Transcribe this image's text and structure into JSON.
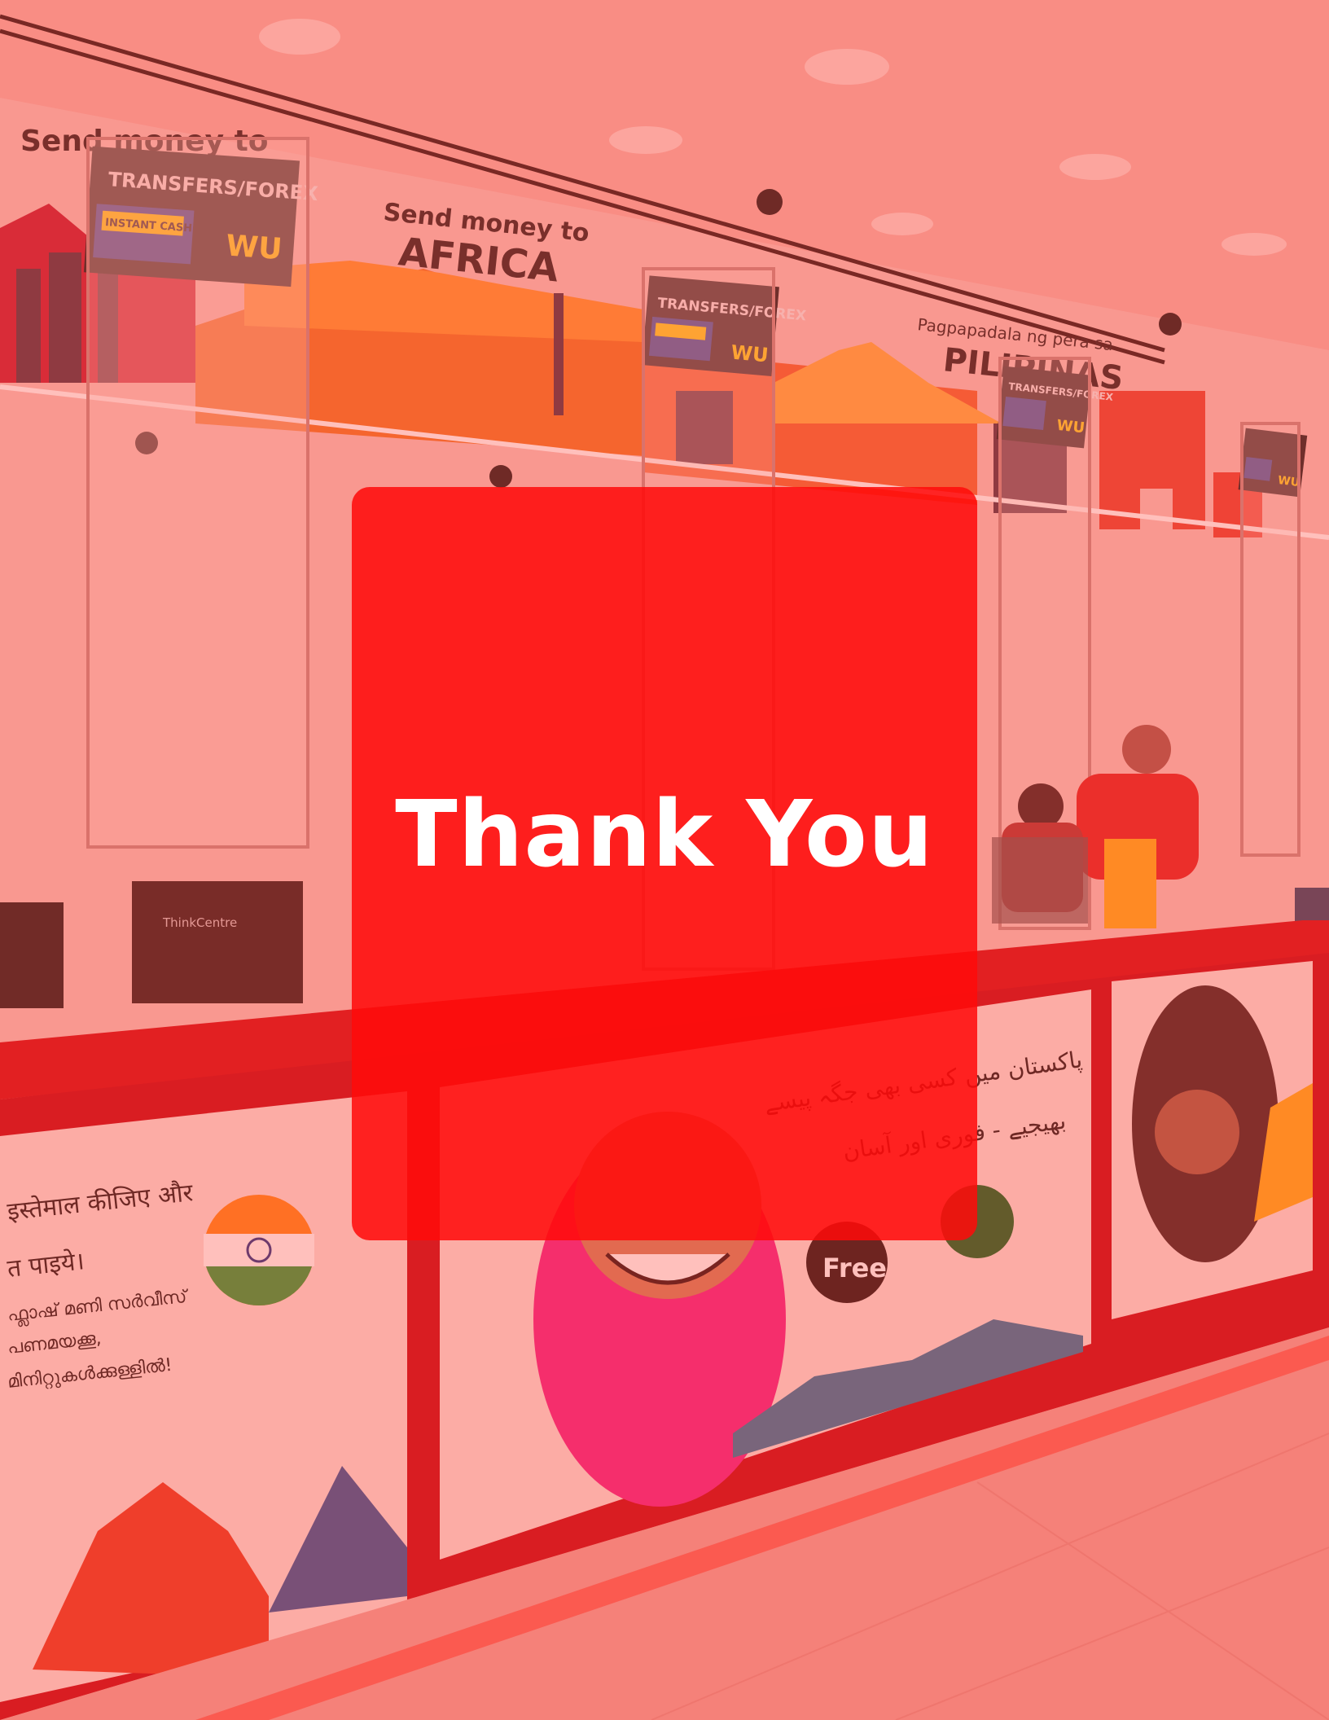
{
  "overlay": {
    "title": "Thank You"
  },
  "signs": {
    "counter_sign_top": "TRANSFERS/FOREX",
    "instant_cash": "INSTANT CASH",
    "wu": "WU"
  },
  "wall": {
    "send_money_left": "Send money to",
    "send_money_africa_line1": "Send money to",
    "send_money_africa_line2": "AFRICA",
    "philippines_line1": "Pagpapadala ng pera sa",
    "philippines_line2": "PILIPINAS"
  },
  "counter": {
    "hindi_line1": "इस्तेमाल कीजिए और",
    "hindi_line2": "त पाइये।",
    "malayalam_line1": "ഫ്ലാഷ് മണി സർവീസ്",
    "malayalam_line2": "പണമയക്കൂ,",
    "malayalam_line3": "മിനിറ്റുകൾക്കുള്ളിൽ!",
    "urdu_line1": "پاکستان میں کسی بھی جگہ پیسے",
    "urdu_line2": "بھیجیے - فوری اور آسان",
    "free_badge": "Free",
    "monitor_brand": "ThinkCentre"
  },
  "colors": {
    "overlay": "#ff0a0a",
    "tint": "#f3a7a0",
    "counter_red": "#d4141c",
    "sign_dark": "#2c2a2a",
    "wu_yellow": "#ffd400",
    "instant_blue": "#2a4aa0"
  }
}
